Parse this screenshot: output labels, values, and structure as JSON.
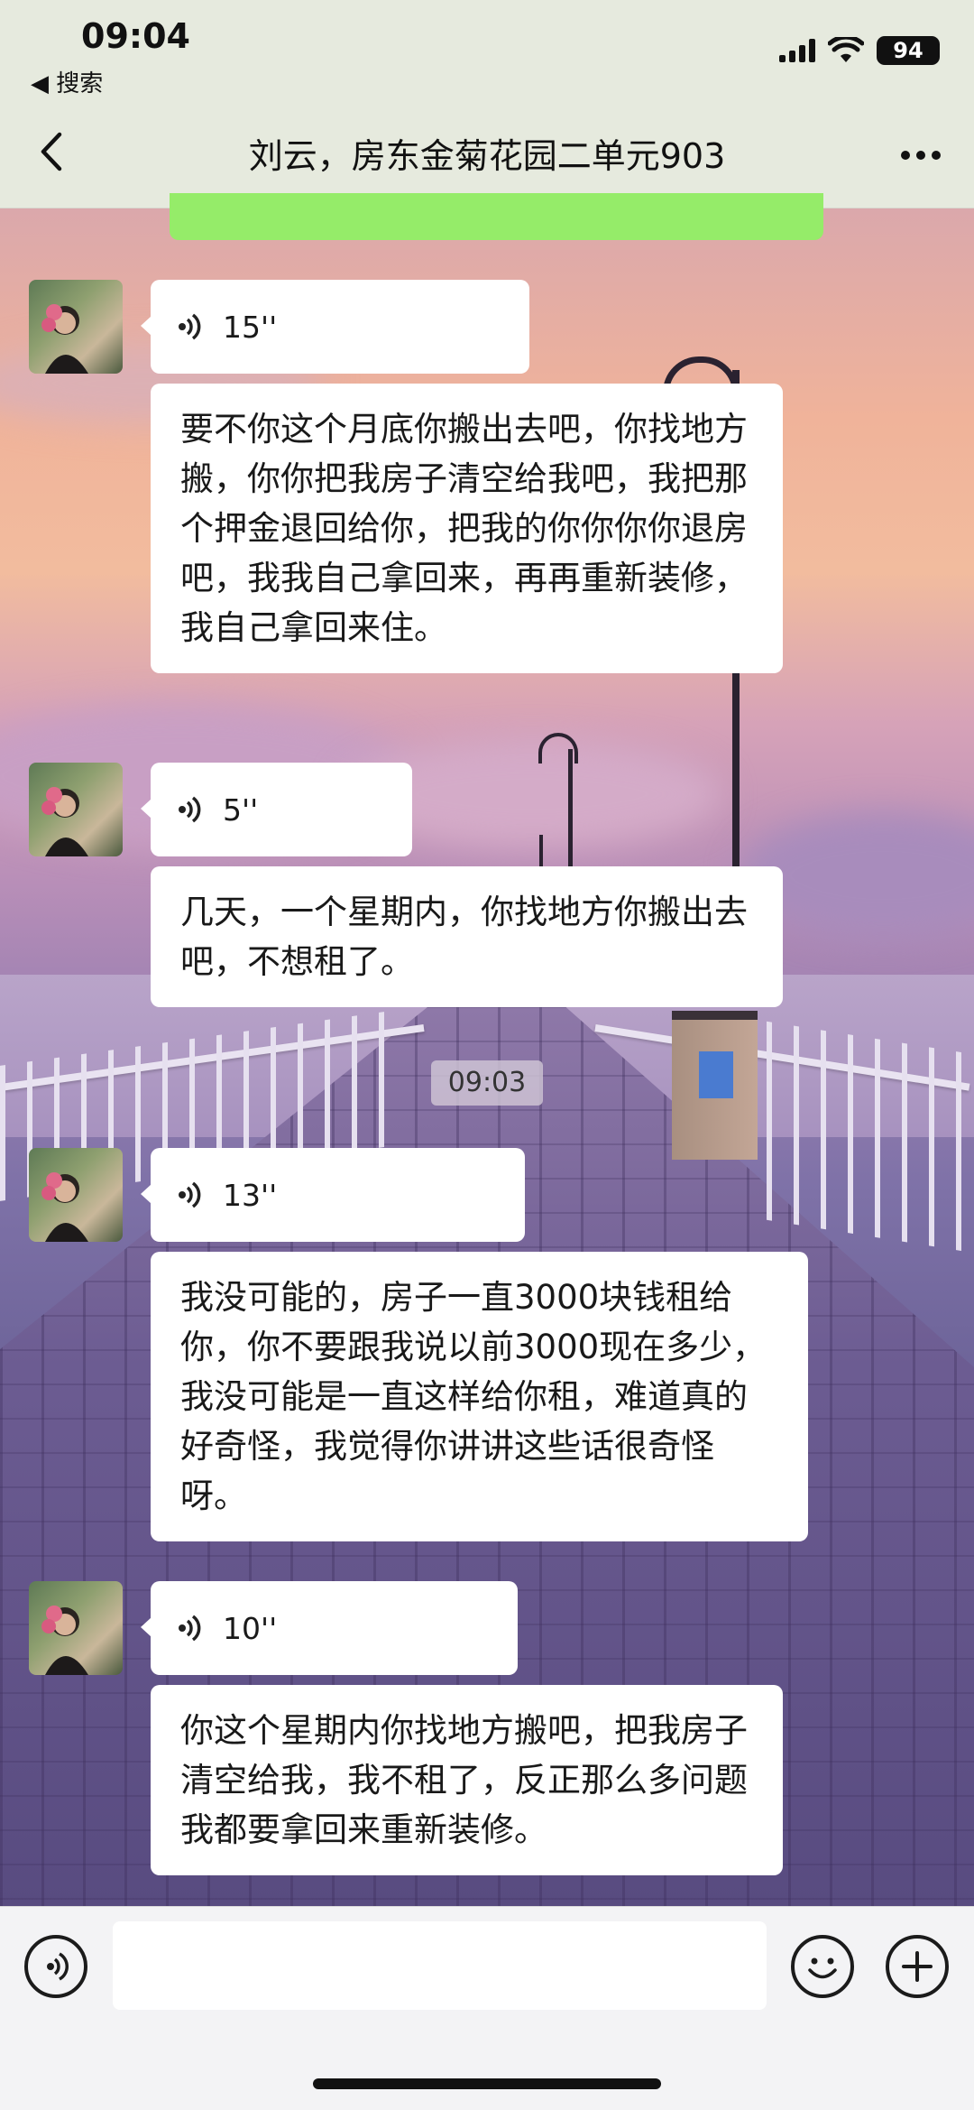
{
  "status_bar": {
    "time": "09:04",
    "back_app": "◀ 搜索",
    "battery": "94"
  },
  "nav": {
    "title": "刘云，房东金菊花园二单元903"
  },
  "messages": [
    {
      "type": "voice",
      "duration": "15''"
    },
    {
      "type": "text",
      "text": "要不你这个月底你搬出去吧，你找地方搬，你你把我房子清空给我吧，我把那个押金退回给你，把我的你你你你退房吧，我我自己拿回来，再再重新装修，我自己拿回来住。"
    },
    {
      "type": "voice",
      "duration": "5''"
    },
    {
      "type": "text",
      "text": "几天，一个星期内，你找地方你搬出去吧，不想租了。"
    },
    {
      "type": "voice",
      "duration": "13''"
    },
    {
      "type": "text",
      "text": "我没可能的，房子一直3000块钱租给你，你不要跟我说以前3000现在多少，我没可能是一直这样给你租，难道真的好奇怪，我觉得你讲讲这些话很奇怪呀。"
    },
    {
      "type": "voice",
      "duration": "10''"
    },
    {
      "type": "text",
      "text": "你这个星期内你找地方搬吧，把我房子清空给我，我不租了，反正那么多问题我都要拿回来重新装修。"
    }
  ],
  "timestamp": "09:03",
  "input": {
    "value": "",
    "placeholder": ""
  },
  "icons": {
    "back": "chevron-left-icon",
    "more": "more-dots-icon",
    "voice_toggle": "voice-input-icon",
    "emoji": "emoji-icon",
    "add": "plus-icon"
  },
  "colors": {
    "sent_bubble": "#95ec69",
    "received_bubble": "#ffffff",
    "nav_bg": "#e6eade"
  }
}
